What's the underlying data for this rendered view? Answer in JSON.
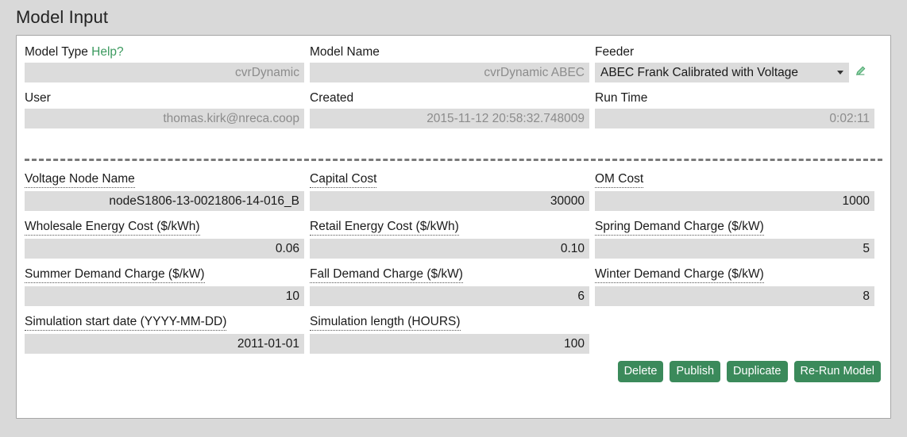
{
  "page": {
    "title": "Model Input"
  },
  "top_section": {
    "rows": [
      [
        {
          "key": "model_type",
          "label": "Model Type",
          "help_label": "Help?",
          "value": "cvrDynamic",
          "kind": "input-disabled"
        },
        {
          "key": "model_name",
          "label": "Model Name",
          "value": "cvrDynamic ABEC",
          "kind": "input-disabled"
        },
        {
          "key": "feeder",
          "label": "Feeder",
          "value": "ABEC Frank Calibrated with Voltage",
          "kind": "select",
          "icon": "pencil-edit-icon"
        }
      ],
      [
        {
          "key": "user",
          "label": "User",
          "value": "thomas.kirk@nreca.coop",
          "kind": "input-disabled"
        },
        {
          "key": "created",
          "label": "Created",
          "value": "2015-11-12 20:58:32.748009",
          "kind": "input-disabled"
        },
        {
          "key": "run_time",
          "label": "Run Time",
          "value": "0:02:11",
          "kind": "input-disabled"
        }
      ]
    ]
  },
  "params_section": {
    "rows": [
      [
        {
          "key": "voltage_node_name",
          "label": "Voltage Node Name",
          "value": "nodeS1806-13-0021806-14-016_B",
          "kind": "input"
        },
        {
          "key": "capital_cost",
          "label": "Capital Cost",
          "value": "30000",
          "kind": "input"
        },
        {
          "key": "om_cost",
          "label": "OM Cost",
          "value": "1000",
          "kind": "input"
        }
      ],
      [
        {
          "key": "wholesale_energy_cost",
          "label": "Wholesale Energy Cost ($/kWh)",
          "value": "0.06",
          "kind": "input"
        },
        {
          "key": "retail_energy_cost",
          "label": "Retail Energy Cost ($/kWh)",
          "value": "0.10",
          "kind": "input"
        },
        {
          "key": "spring_demand_charge",
          "label": "Spring Demand Charge ($/kW)",
          "value": "5",
          "kind": "input"
        }
      ],
      [
        {
          "key": "summer_demand_charge",
          "label": "Summer Demand Charge ($/kW)",
          "value": "10",
          "kind": "input"
        },
        {
          "key": "fall_demand_charge",
          "label": "Fall Demand Charge ($/kW)",
          "value": "6",
          "kind": "input"
        },
        {
          "key": "winter_demand_charge",
          "label": "Winter Demand Charge ($/kW)",
          "value": "8",
          "kind": "input"
        }
      ],
      [
        {
          "key": "simulation_start_date",
          "label": "Simulation start date (YYYY-MM-DD)",
          "value": "2011-01-01",
          "kind": "input"
        },
        {
          "key": "simulation_length",
          "label": "Simulation length (HOURS)",
          "value": "100",
          "kind": "input"
        },
        {
          "key": "spacer",
          "label": "",
          "value": "",
          "kind": "empty"
        }
      ]
    ]
  },
  "actions": {
    "buttons": [
      {
        "key": "delete",
        "label": "Delete"
      },
      {
        "key": "publish",
        "label": "Publish"
      },
      {
        "key": "duplicate",
        "label": "Duplicate"
      },
      {
        "key": "rerun",
        "label": "Re-Run Model"
      }
    ]
  },
  "colors": {
    "page_background": "#d9d9d9",
    "card_background": "#ffffff",
    "card_border": "#a6a6a6",
    "input_background": "#dcdcdc",
    "input_text": "#1a1a1a",
    "disabled_text": "#8c8c8c",
    "link_green": "#3c9a5f",
    "button_green": "#3b8a5b",
    "divider": "#7a7a7a"
  }
}
